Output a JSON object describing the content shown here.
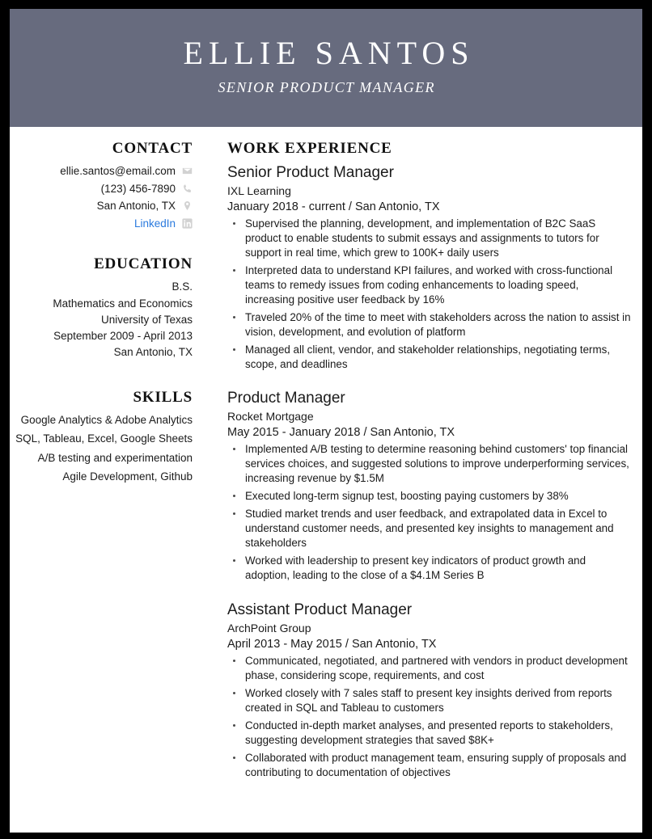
{
  "theme": {
    "header_bg": "#676b7e",
    "border": "#000000",
    "text": "#1b1b1b",
    "link": "#2a7ade",
    "icon": "#d2d2d2"
  },
  "header": {
    "name": "ELLIE SANTOS",
    "subtitle": "SENIOR PRODUCT MANAGER"
  },
  "contact": {
    "heading": "CONTACT",
    "items": [
      {
        "text": "ellie.santos@email.com",
        "icon": "envelope-icon",
        "link": false
      },
      {
        "text": "(123) 456-7890",
        "icon": "phone-icon",
        "link": false
      },
      {
        "text": "San Antonio, TX",
        "icon": "map-pin-icon",
        "link": false
      },
      {
        "text": "LinkedIn",
        "icon": "linkedin-icon",
        "link": true
      }
    ]
  },
  "education": {
    "heading": "EDUCATION",
    "lines": [
      "B.S.",
      "Mathematics and Economics",
      "University of Texas",
      "September 2009 - April 2013",
      "San Antonio, TX"
    ]
  },
  "skills": {
    "heading": "SKILLS",
    "items": [
      "Google Analytics & Adobe Analytics",
      "SQL, Tableau, Excel, Google Sheets",
      "A/B testing and experimentation",
      "Agile Development, Github"
    ]
  },
  "experience": {
    "heading": "WORK EXPERIENCE",
    "jobs": [
      {
        "title": "Senior Product Manager",
        "company": "IXL Learning",
        "meta": "January 2018 - current  /  San Antonio, TX",
        "bullets": [
          "Supervised the planning, development, and implementation of B2C SaaS product to enable students to submit essays and assignments to tutors for support in real time, which grew to 100K+ daily users",
          "Interpreted data to understand KPI failures, and worked with cross-functional teams to remedy issues from coding enhancements to loading speed, increasing positive user feedback by 16%",
          "Traveled 20% of the time to meet with stakeholders across the nation to assist in vision, development, and evolution of platform",
          "Managed all client, vendor, and stakeholder relationships, negotiating terms, scope, and deadlines"
        ]
      },
      {
        "title": "Product Manager",
        "company": "Rocket Mortgage",
        "meta": "May 2015 - January 2018  /  San Antonio, TX",
        "bullets": [
          "Implemented A/B testing to determine reasoning behind customers' top financial services choices, and suggested solutions to improve underperforming services, increasing revenue by $1.5M",
          "Executed long-term signup test, boosting paying customers by 38%",
          "Studied market trends and user feedback, and extrapolated data in Excel to understand customer needs, and presented key insights to management and stakeholders",
          "Worked with leadership to present key indicators of product growth and adoption, leading to the close of a $4.1M Series B"
        ]
      },
      {
        "title": "Assistant Product Manager",
        "company": "ArchPoint Group",
        "meta": "April 2013 - May 2015  /  San Antonio, TX",
        "bullets": [
          "Communicated, negotiated, and partnered with vendors in product development phase, considering scope, requirements, and cost",
          "Worked closely with 7 sales staff to present key insights derived from reports created in SQL and Tableau to customers",
          "Conducted in-depth market analyses, and presented reports to stakeholders, suggesting development strategies that saved $8K+",
          "Collaborated with product management team, ensuring supply of proposals and contributing to documentation of objectives"
        ]
      }
    ]
  }
}
